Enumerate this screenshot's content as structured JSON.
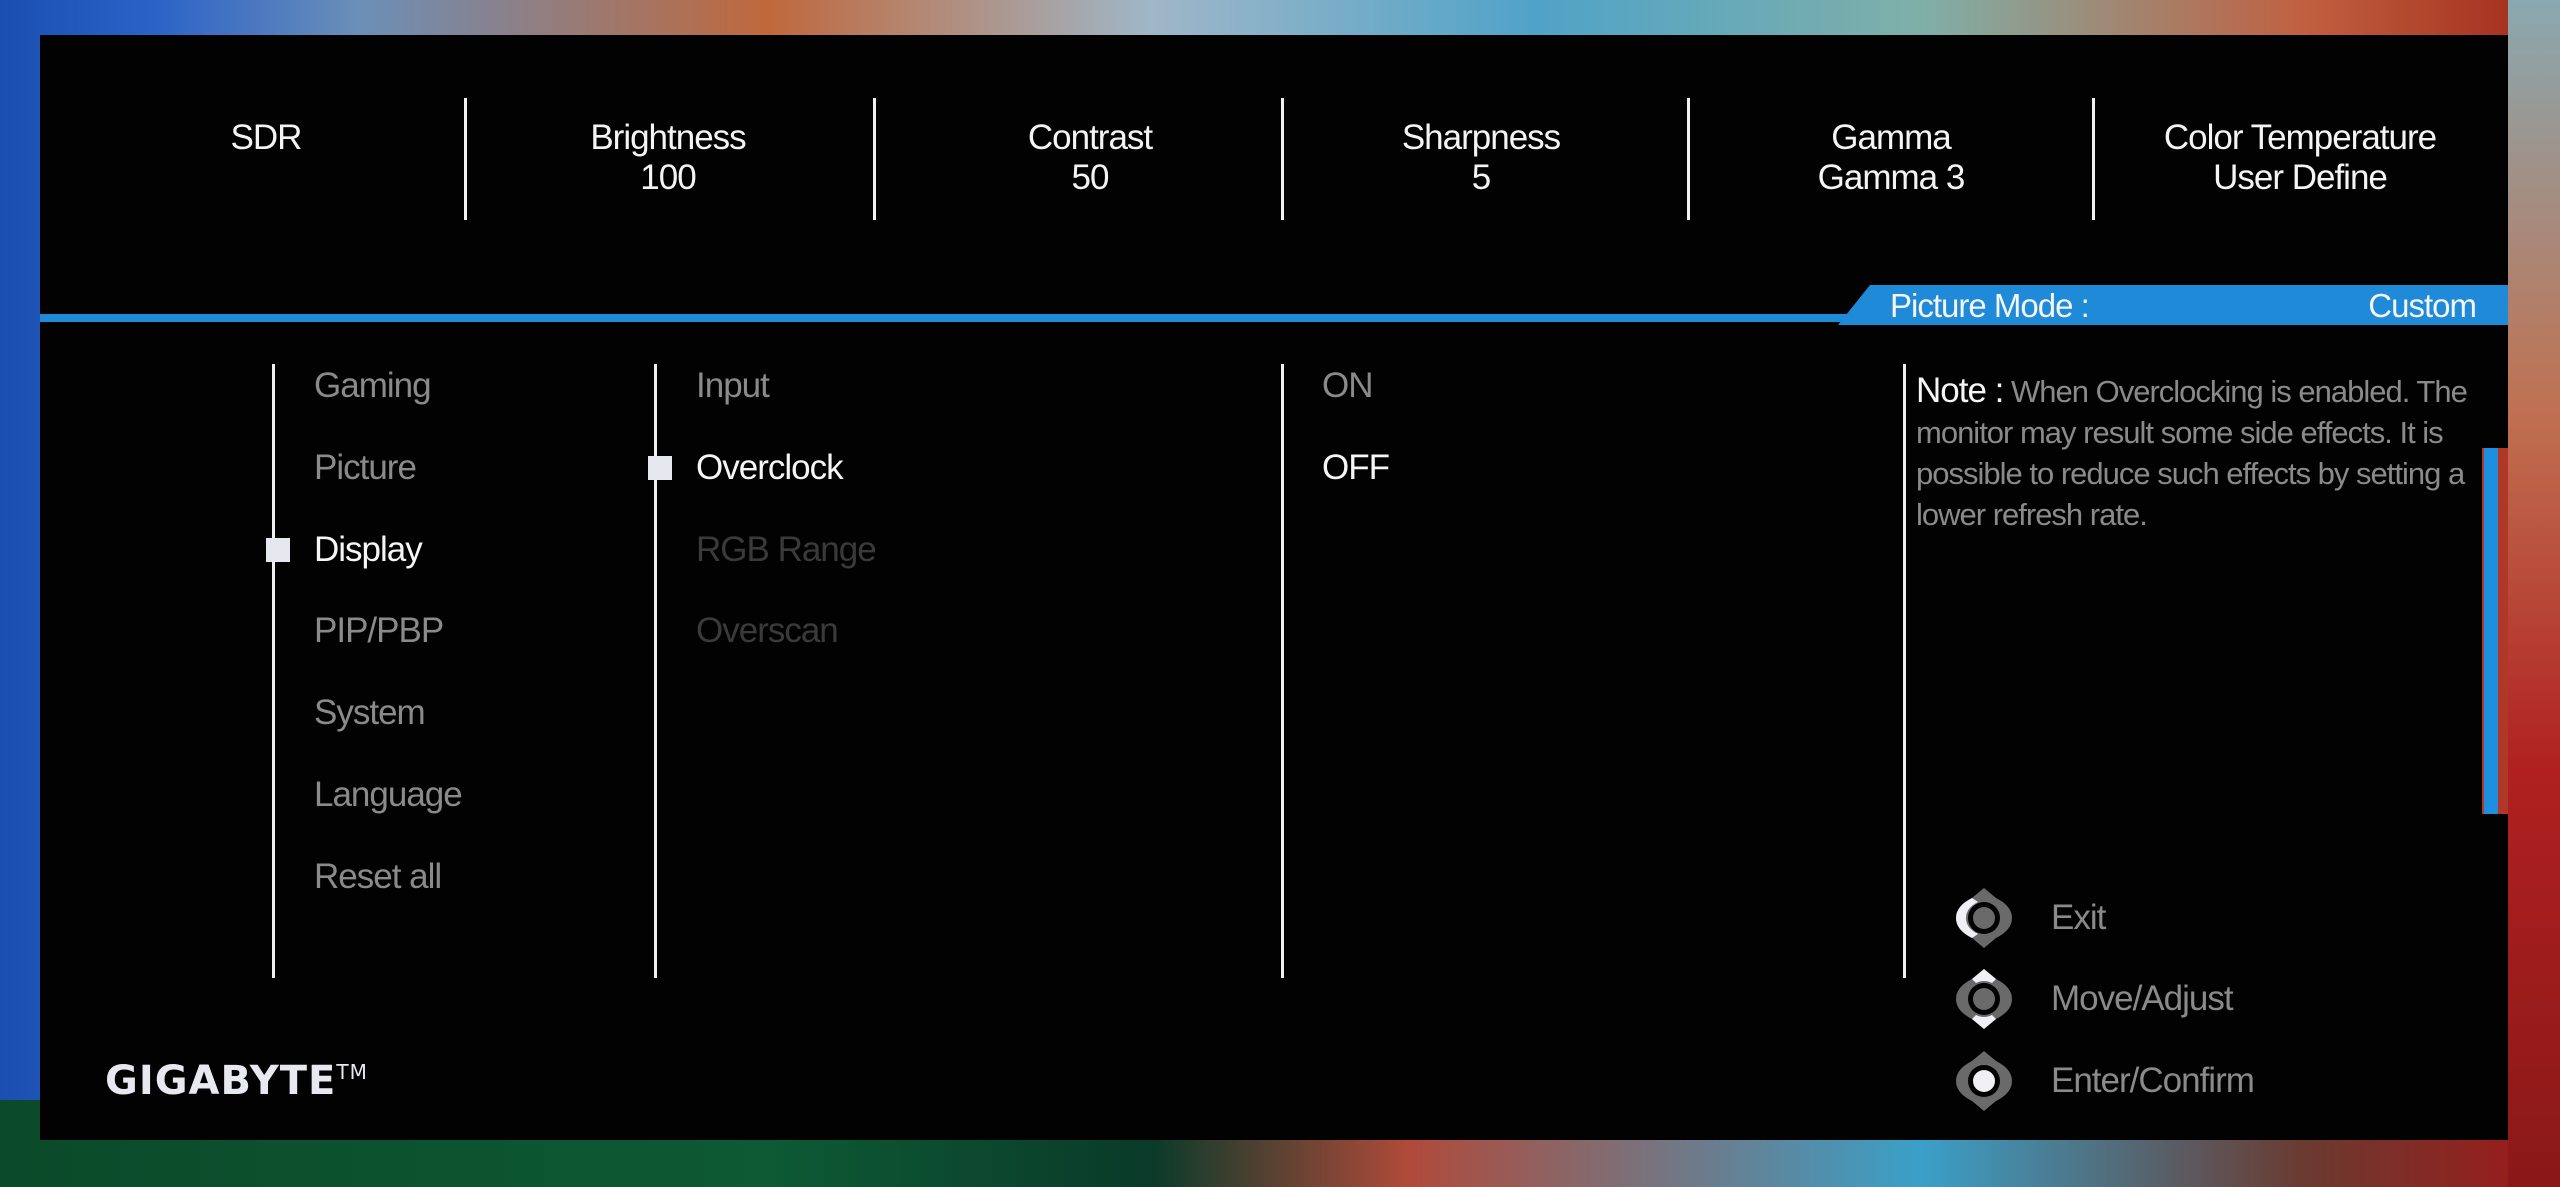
{
  "header": {
    "items": [
      {
        "label": "SDR",
        "value": ""
      },
      {
        "label": "Brightness",
        "value": "100"
      },
      {
        "label": "Contrast",
        "value": "50"
      },
      {
        "label": "Sharpness",
        "value": "5"
      },
      {
        "label": "Gamma",
        "value": "Gamma 3"
      },
      {
        "label": "Color Temperature",
        "value": "User Define"
      }
    ]
  },
  "picture_mode": {
    "label": "Picture Mode  :",
    "value": "Custom"
  },
  "main_menu": {
    "items": [
      {
        "label": "Gaming",
        "state": "normal"
      },
      {
        "label": "Picture",
        "state": "normal"
      },
      {
        "label": "Display",
        "state": "selected"
      },
      {
        "label": "PIP/PBP",
        "state": "normal"
      },
      {
        "label": "System",
        "state": "normal"
      },
      {
        "label": "Language",
        "state": "normal"
      },
      {
        "label": "Reset all",
        "state": "normal"
      }
    ]
  },
  "sub_menu": {
    "items": [
      {
        "label": "Input",
        "state": "normal"
      },
      {
        "label": "Overclock",
        "state": "selected"
      },
      {
        "label": "RGB Range",
        "state": "disabled"
      },
      {
        "label": "Overscan",
        "state": "disabled"
      }
    ]
  },
  "options": {
    "items": [
      {
        "label": "ON",
        "state": "normal"
      },
      {
        "label": "OFF",
        "state": "selected"
      }
    ]
  },
  "note": {
    "label": "Note :",
    "text": "When Overclocking is enabled. The monitor may result some side effects.  It is possible to reduce such effects by setting a lower  refresh rate."
  },
  "controls": [
    {
      "icon": "joystick-left-icon",
      "label": "Exit"
    },
    {
      "icon": "joystick-updown-icon",
      "label": "Move/Adjust"
    },
    {
      "icon": "joystick-press-icon",
      "label": "Enter/Confirm"
    }
  ],
  "brand": {
    "name": "GIGABYTE",
    "trademark": "TM"
  },
  "colors": {
    "accent": "#1e8ad8",
    "active_text": "#f6f6f6",
    "inactive_text": "#8a8a8a",
    "disabled_text": "#3a3a3a",
    "panel_bg": "#020202"
  }
}
